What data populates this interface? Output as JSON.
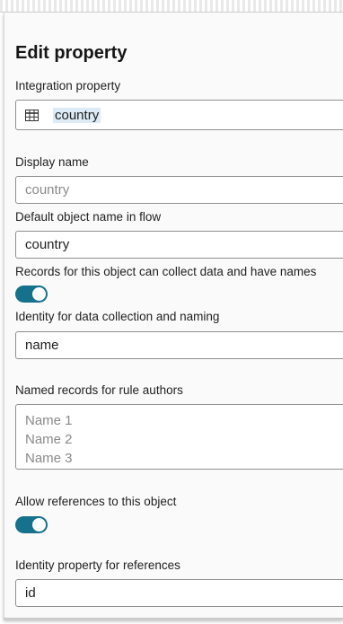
{
  "title": "Edit property",
  "integration_property": {
    "label": "Integration property",
    "value": "country",
    "icon": "table-icon"
  },
  "display_name": {
    "label": "Display name",
    "placeholder": "country"
  },
  "default_object_name": {
    "label": "Default object name in flow",
    "value": "country"
  },
  "records_collect": {
    "label": "Records for this object can collect data and have names",
    "enabled": true
  },
  "identity_collection": {
    "label": "Identity for data collection and naming",
    "value": "name"
  },
  "named_records": {
    "label": "Named records for rule authors",
    "placeholder_lines": [
      "Name 1",
      "Name 2",
      "Name 3"
    ]
  },
  "allow_references": {
    "label": "Allow references to this object",
    "enabled": true
  },
  "identity_references": {
    "label": "Identity property for references",
    "value": "id"
  },
  "colors": {
    "toggle_on": "#16718d",
    "selection_highlight": "#dcebf6"
  }
}
